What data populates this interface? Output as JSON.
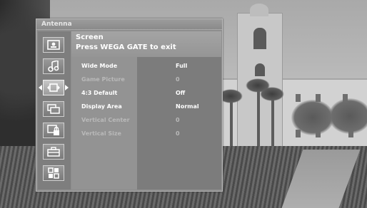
{
  "menu": {
    "title": "Antenna",
    "header": {
      "line1": "Screen",
      "line2": "Press WEGA GATE to exit"
    },
    "sidebar_icons": [
      {
        "name": "picture-icon",
        "active": false
      },
      {
        "name": "sound-icon",
        "active": false
      },
      {
        "name": "screen-icon",
        "active": true
      },
      {
        "name": "channel-icon",
        "active": false
      },
      {
        "name": "parental-lock-icon",
        "active": false
      },
      {
        "name": "setup-icon",
        "active": false
      },
      {
        "name": "applications-icon",
        "active": false
      }
    ],
    "settings": [
      {
        "label": "Wide Mode",
        "value": "Full",
        "enabled": true
      },
      {
        "label": "Game Picture",
        "value": "0",
        "enabled": false
      },
      {
        "label": "4:3 Default",
        "value": "Off",
        "enabled": true
      },
      {
        "label": "Display Area",
        "value": "Normal",
        "enabled": true
      },
      {
        "label": "Vertical Center",
        "value": "0",
        "enabled": false
      },
      {
        "label": "Vertical Size",
        "value": "0",
        "enabled": false
      }
    ]
  }
}
